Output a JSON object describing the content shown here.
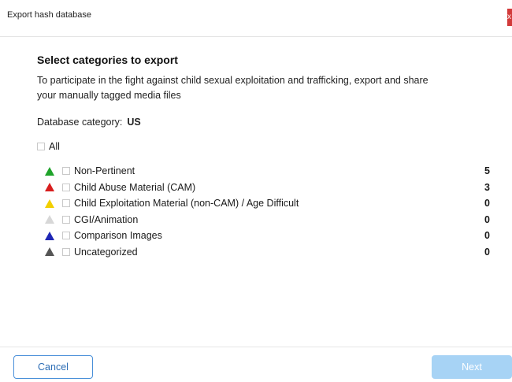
{
  "window": {
    "title": "Export hash database",
    "close_label": "x"
  },
  "main": {
    "heading": "Select categories to export",
    "description": "To participate in the fight against child sexual exploitation and trafficking, export and share your manually tagged media files",
    "db_category_label": "Database category:",
    "db_category_value": "US",
    "all_label": "All"
  },
  "categories": [
    {
      "label": "Non-Pertinent",
      "count": "5",
      "color": "#1fa32a"
    },
    {
      "label": "Child Abuse Material (CAM)",
      "count": "3",
      "color": "#d81e1e"
    },
    {
      "label": "Child Exploitation Material  (non-CAM) / Age Difficult",
      "count": "0",
      "color": "#f2cf00"
    },
    {
      "label": "CGI/Animation",
      "count": "0",
      "color": "#d7d7d7"
    },
    {
      "label": "Comparison Images",
      "count": "0",
      "color": "#1f27b5"
    },
    {
      "label": "Uncategorized",
      "count": "0",
      "color": "#555555"
    }
  ],
  "footer": {
    "cancel_label": "Cancel",
    "next_label": "Next"
  }
}
